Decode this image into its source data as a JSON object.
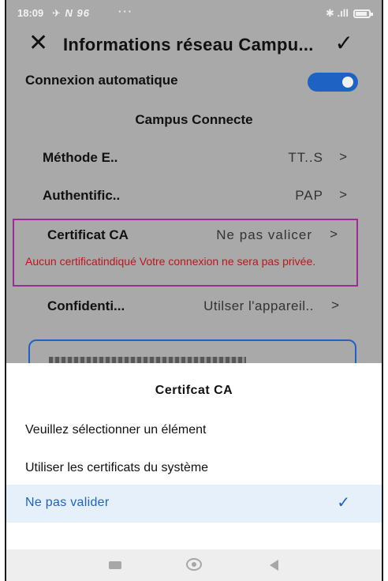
{
  "status": {
    "time": "18:09",
    "left_icons": "✈ N 96",
    "dots": "···",
    "right_icons": "✱ .ıll"
  },
  "header": {
    "title": "Informations réseau Campu...",
    "close_icon": "close-icon",
    "confirm_icon": "check-icon"
  },
  "auto_connect": {
    "label": "Connexion automatique",
    "enabled": true
  },
  "section_title": "Campus Connecte",
  "settings": [
    {
      "label": "Méthode E..",
      "value": "TT..S"
    },
    {
      "label": "Authentific..",
      "value": "PAP"
    },
    {
      "label": "Certificat CA",
      "value": "Ne pas valicer"
    },
    {
      "label": "Confidenti...",
      "value": "Utilser l'appareil.."
    }
  ],
  "warning": "Aucun certificatindiqué Votre connexion ne sera pas privée.",
  "sheet": {
    "title": "Certifcat CA",
    "options": [
      "Veuillez sélectionner un élément",
      "Utiliser les certificats du système",
      "Ne pas valider"
    ],
    "selected_index": 2
  },
  "colors": {
    "accent": "#1e63c4",
    "warning": "#c0141c",
    "highlight_border": "#9b2d96",
    "dim_background": "#a9a9a9"
  }
}
